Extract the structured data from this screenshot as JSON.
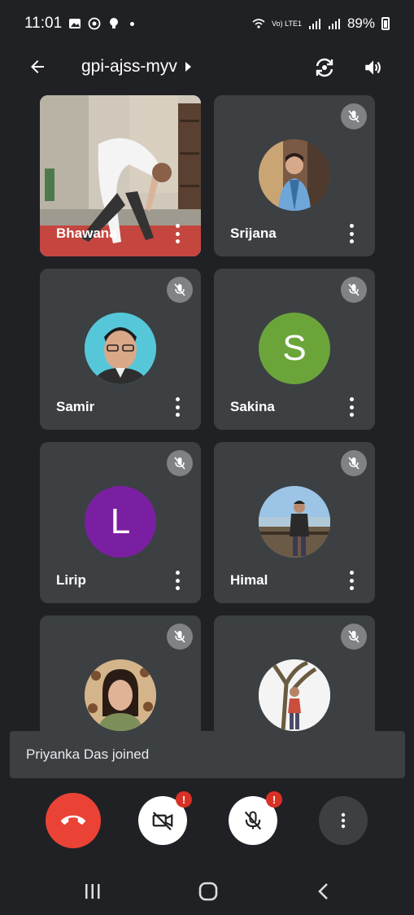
{
  "status_bar": {
    "time": "11:01",
    "network_label": "Vo) LTE1",
    "battery": "89%"
  },
  "app_bar": {
    "meeting_code": "gpi-ajss-myv"
  },
  "participants": [
    {
      "name": "Bhawana",
      "type": "video"
    },
    {
      "name": "Srijana",
      "type": "photo",
      "muted": true
    },
    {
      "name": "Samir",
      "type": "photo",
      "muted": true
    },
    {
      "name": "Sakina",
      "type": "letter",
      "initial": "S",
      "color": "#6ba53a",
      "muted": true
    },
    {
      "name": "Lirip",
      "type": "letter",
      "initial": "L",
      "color": "#7b1fa2",
      "muted": true
    },
    {
      "name": "Himal",
      "type": "photo",
      "muted": true
    },
    {
      "name": "",
      "type": "photo",
      "muted": true
    },
    {
      "name": "",
      "type": "photo",
      "muted": true
    }
  ],
  "toast": {
    "message": "Priyanka Das joined"
  },
  "controls": {
    "camera_alert": "!",
    "mic_alert": "!"
  },
  "colors": {
    "background": "#202124",
    "tile": "#3c4043",
    "end_call": "#ea4335",
    "alert": "#d93025"
  }
}
